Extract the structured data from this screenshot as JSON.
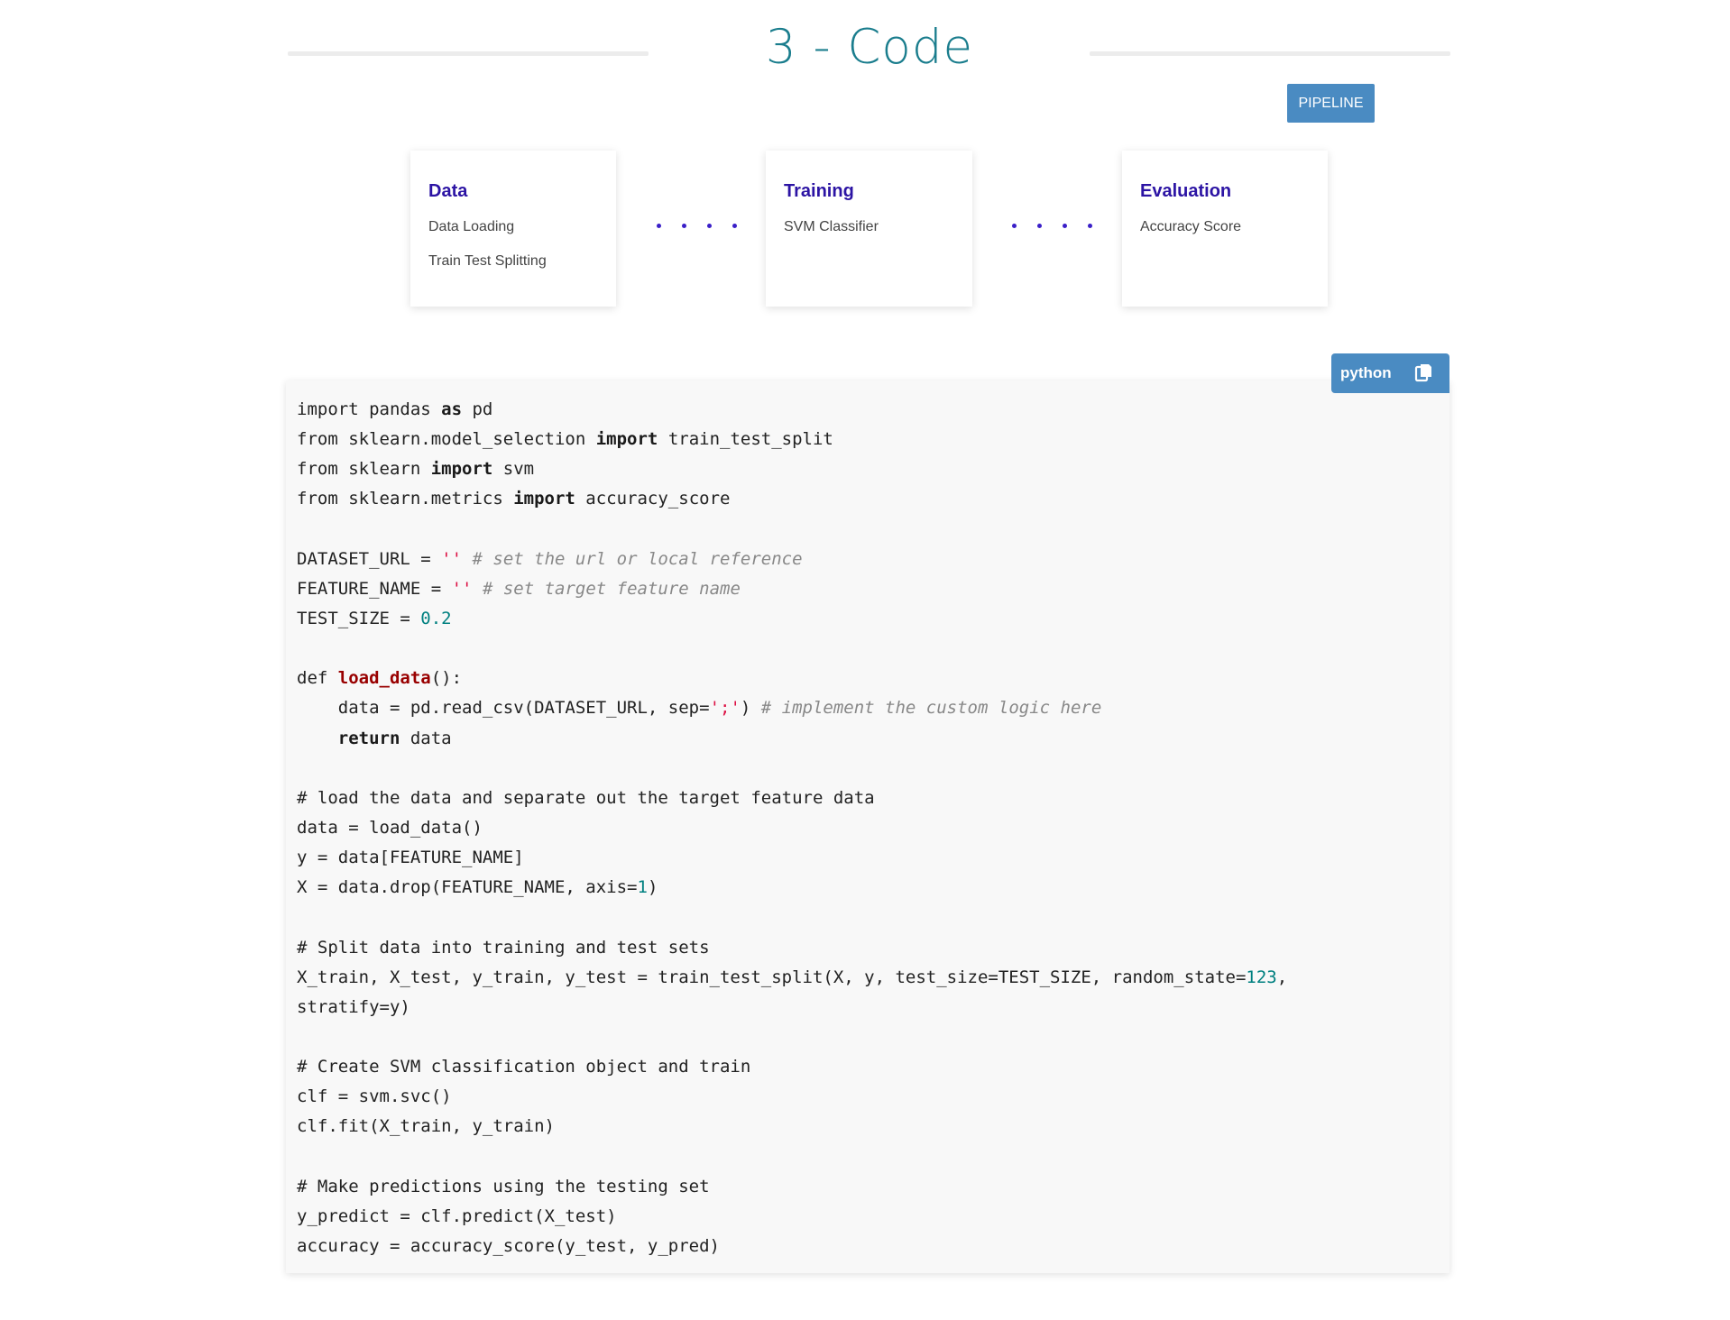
{
  "section": {
    "title": "3 - Code"
  },
  "pipeline_button": {
    "label": "PIPELINE"
  },
  "stages": [
    {
      "title": "Data",
      "items": [
        "Data Loading",
        "Train Test Splitting"
      ]
    },
    {
      "title": "Training",
      "items": [
        "SVM Classifier"
      ]
    },
    {
      "title": "Evaluation",
      "items": [
        "Accuracy Score"
      ]
    }
  ],
  "code": {
    "language": "python",
    "copy_icon": "copy-icon",
    "lines": [
      [
        [
          "import pandas "
        ],
        [
          "as",
          "kw"
        ],
        [
          " pd"
        ]
      ],
      [
        [
          "from sklearn.model_selection "
        ],
        [
          "import",
          "kw"
        ],
        [
          " train_test_split"
        ]
      ],
      [
        [
          "from sklearn "
        ],
        [
          "import",
          "kw"
        ],
        [
          " svm"
        ]
      ],
      [
        [
          "from sklearn.metrics "
        ],
        [
          "import",
          "kw"
        ],
        [
          " accuracy_score"
        ]
      ],
      [],
      [
        [
          "DATASET_URL = "
        ],
        [
          "''",
          "str"
        ],
        [
          " "
        ],
        [
          "# set the url or local reference",
          "cmt"
        ]
      ],
      [
        [
          "FEATURE_NAME = "
        ],
        [
          "''",
          "str"
        ],
        [
          " "
        ],
        [
          "# set target feature name",
          "cmt"
        ]
      ],
      [
        [
          "TEST_SIZE = "
        ],
        [
          "0.2",
          "num"
        ]
      ],
      [],
      [
        [
          "def "
        ],
        [
          "load_data",
          "fn"
        ],
        [
          "():"
        ]
      ],
      [
        [
          "    data = pd.read_csv(DATASET_URL, sep="
        ],
        [
          "';'",
          "str"
        ],
        [
          ") "
        ],
        [
          "# implement the custom logic here",
          "cmt"
        ]
      ],
      [
        [
          "    "
        ],
        [
          "return",
          "kw"
        ],
        [
          " data"
        ]
      ],
      [],
      [
        [
          "# load the data and separate out the target feature data"
        ]
      ],
      [
        [
          "data = load_data()"
        ]
      ],
      [
        [
          "y = data[FEATURE_NAME]"
        ]
      ],
      [
        [
          "X = data.drop(FEATURE_NAME, axis="
        ],
        [
          "1",
          "num"
        ],
        [
          ")"
        ]
      ],
      [],
      [
        [
          "# Split data into training and test sets"
        ]
      ],
      [
        [
          "X_train, X_test, y_train, y_test = train_test_split(X, y, test_size=TEST_SIZE, random_state="
        ],
        [
          "123",
          "num"
        ],
        [
          ","
        ]
      ],
      [
        [
          "stratify=y)"
        ]
      ],
      [],
      [
        [
          "# Create SVM classification object and train"
        ]
      ],
      [
        [
          "clf = svm.svc()"
        ]
      ],
      [
        [
          "clf.fit(X_train, y_train)"
        ]
      ],
      [],
      [
        [
          "# Make predictions using the testing set"
        ]
      ],
      [
        [
          "y_predict = clf.predict(X_test)"
        ]
      ],
      [
        [
          "accuracy = accuracy_score(y_test, y_pred)"
        ]
      ]
    ]
  }
}
